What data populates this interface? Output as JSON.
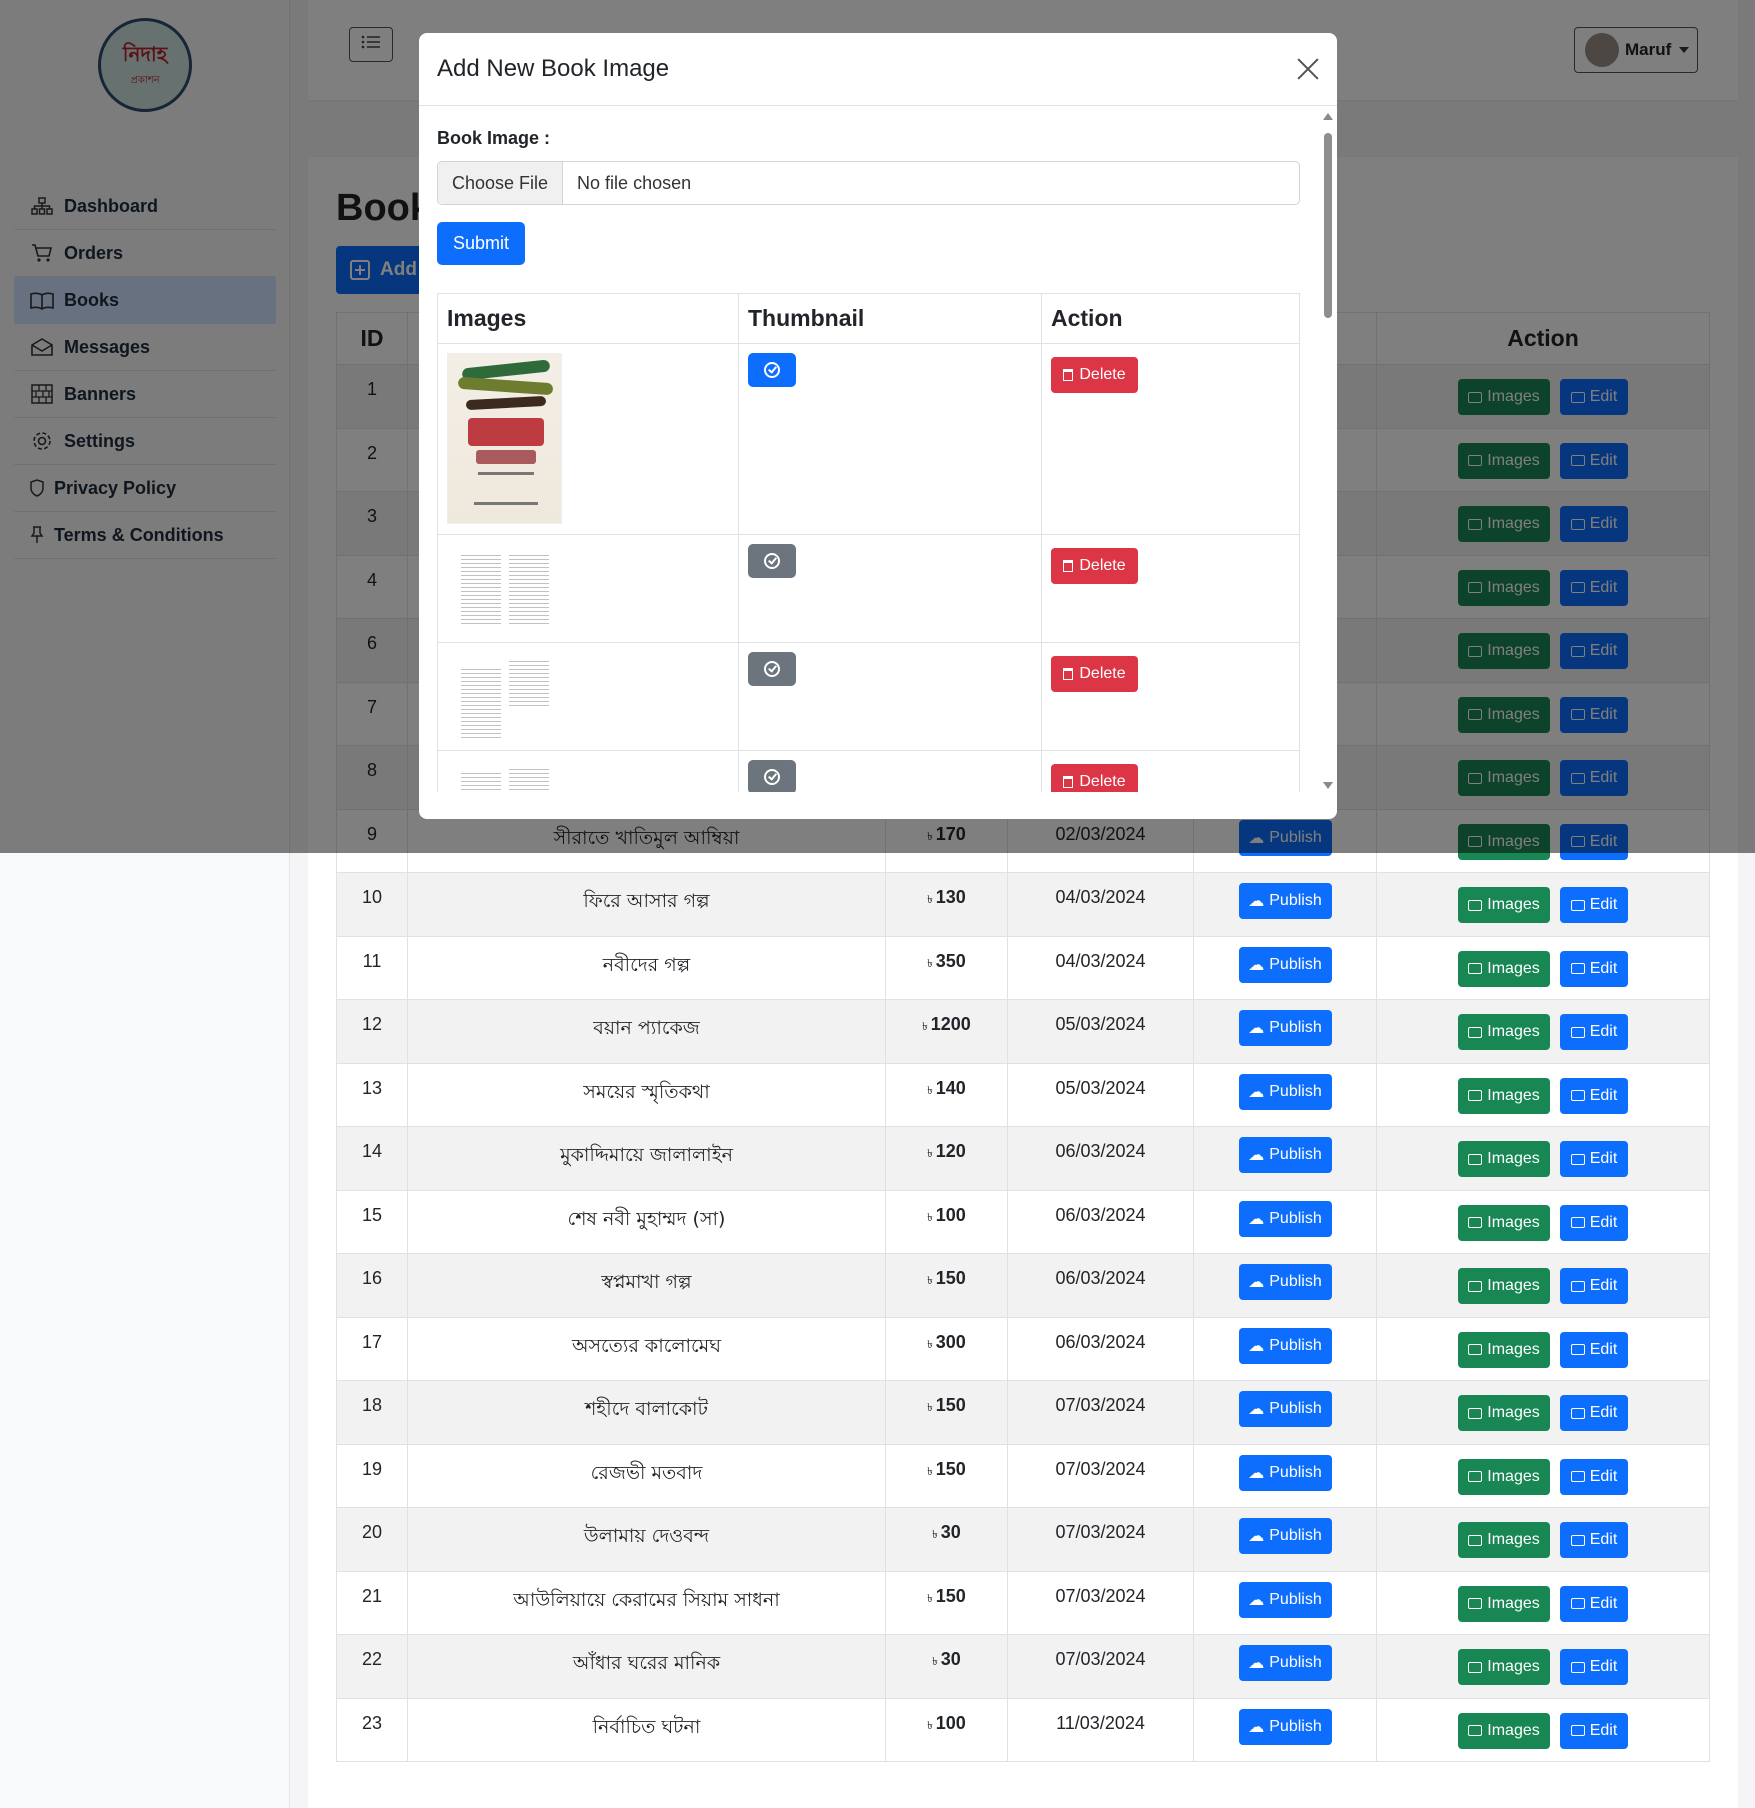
{
  "sidebar": {
    "logo_text": "নিদাহ",
    "logo_sub": "প্রকাশন",
    "items": [
      {
        "label": "Dashboard",
        "icon": "sitemap-icon"
      },
      {
        "label": "Orders",
        "icon": "cart-icon"
      },
      {
        "label": "Books",
        "icon": "book-icon"
      },
      {
        "label": "Messages",
        "icon": "envelope-icon"
      },
      {
        "label": "Banners",
        "icon": "bricks-icon"
      },
      {
        "label": "Settings",
        "icon": "gear-icon"
      },
      {
        "label": "Privacy Policy",
        "icon": "shield-icon"
      },
      {
        "label": "Terms & Conditions",
        "icon": "pin-icon"
      }
    ]
  },
  "header": {
    "user_name": "Maruf"
  },
  "main": {
    "title": "Book",
    "add_label": "Add",
    "table": {
      "headers": {
        "id": "ID",
        "action": "Action"
      },
      "rows": [
        {
          "id": "1"
        },
        {
          "id": "2"
        },
        {
          "id": "3"
        },
        {
          "id": "4"
        },
        {
          "id": "6"
        },
        {
          "id": "7"
        },
        {
          "id": "8"
        },
        {
          "id": "9",
          "name": "সীরাতে খাতিমুল আম্বিয়া",
          "price": "170",
          "date": "02/03/2024"
        },
        {
          "id": "10",
          "name": "ফিরে আসার গল্প",
          "price": "130",
          "date": "04/03/2024"
        },
        {
          "id": "11",
          "name": "নবীদের গল্প",
          "price": "350",
          "date": "04/03/2024"
        },
        {
          "id": "12",
          "name": "বয়ান প্যাকেজ",
          "price": "1200",
          "date": "05/03/2024"
        },
        {
          "id": "13",
          "name": "সময়ের স্মৃতিকথা",
          "price": "140",
          "date": "05/03/2024"
        },
        {
          "id": "14",
          "name": "মুকাদ্দিমায়ে জালালাইন",
          "price": "120",
          "date": "06/03/2024"
        },
        {
          "id": "15",
          "name": "শেষ নবী মুহাম্মদ (সা)",
          "price": "100",
          "date": "06/03/2024"
        },
        {
          "id": "16",
          "name": "স্বপ্নমাখা গল্প",
          "price": "150",
          "date": "06/03/2024"
        },
        {
          "id": "17",
          "name": "অসত্যের কালোমেঘ",
          "price": "300",
          "date": "06/03/2024"
        },
        {
          "id": "18",
          "name": "শহীদে বালাকোট",
          "price": "150",
          "date": "07/03/2024"
        },
        {
          "id": "19",
          "name": "রেজভী মতবাদ",
          "price": "150",
          "date": "07/03/2024"
        },
        {
          "id": "20",
          "name": "উলামায় দেওবন্দ",
          "price": "30",
          "date": "07/03/2024"
        },
        {
          "id": "21",
          "name": "আউলিয়ায়ে কেরামের সিয়াম সাধনা",
          "price": "150",
          "date": "07/03/2024"
        },
        {
          "id": "22",
          "name": "আঁধার ঘরের মানিক",
          "price": "30",
          "date": "07/03/2024"
        },
        {
          "id": "23",
          "name": "নির্বাচিত ঘটনা",
          "price": "100",
          "date": "11/03/2024"
        }
      ],
      "currency_symbol": "৳",
      "publish_label": "Publish",
      "images_label": "Images",
      "edit_label": "Edit"
    }
  },
  "modal": {
    "title": "Add New Book Image",
    "field_label": "Book Image :",
    "choose_file_label": "Choose File",
    "no_file_text": "No file chosen",
    "submit_label": "Submit",
    "table_headers": [
      "Images",
      "Thumbnail",
      "Action"
    ],
    "rows": [
      {
        "image": "book-cover",
        "thumbnail_state": "selected"
      },
      {
        "image": "page-scan",
        "thumbnail_state": "unselected"
      },
      {
        "image": "page-scan",
        "thumbnail_state": "unselected"
      },
      {
        "image": "page-scan",
        "thumbnail_state": "unselected"
      }
    ],
    "delete_label": "Delete"
  },
  "colors": {
    "primary": "#0d6efd",
    "success": "#198754",
    "danger": "#dc3545",
    "secondary": "#6c757d",
    "active_nav": "#cfe2ff"
  }
}
